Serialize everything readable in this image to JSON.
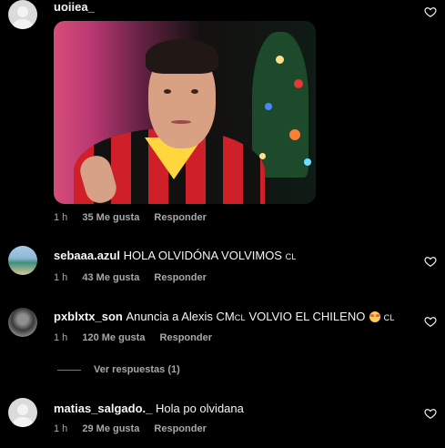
{
  "comments": [
    {
      "username": "uoiiea_",
      "text": "",
      "time": "1 h",
      "likes": "35 Me gusta",
      "reply": "Responder",
      "has_gif": true
    },
    {
      "username": "sebaaa.azul",
      "text": "HOLA OLVIDÓNA VOLVIMOS",
      "suffix": "CL",
      "time": "1 h",
      "likes": "43 Me gusta",
      "reply": "Responder"
    },
    {
      "username": "pxblxtx_son",
      "text": "Anuncia a Alexis CM",
      "cm_suffix": "CL",
      "text_after": " VOLVIO EL CHILENO",
      "suffix": "CL",
      "time": "1 h",
      "likes": "120 Me gusta",
      "reply": "Responder",
      "view_replies": "Ver respuestas (1)"
    },
    {
      "username": "matias_salgado._",
      "text": "Hola po olvidana",
      "time": "1 h",
      "likes": "29 Me gusta",
      "reply": "Responder"
    }
  ],
  "icons": {
    "heart": "heart-icon",
    "default_avatar": "default-avatar-icon",
    "emoji": "heart-eyes-emoji-icon"
  },
  "colors": {
    "background": "#000000",
    "text": "#f5f5f5",
    "muted": "#a8a8a8"
  }
}
